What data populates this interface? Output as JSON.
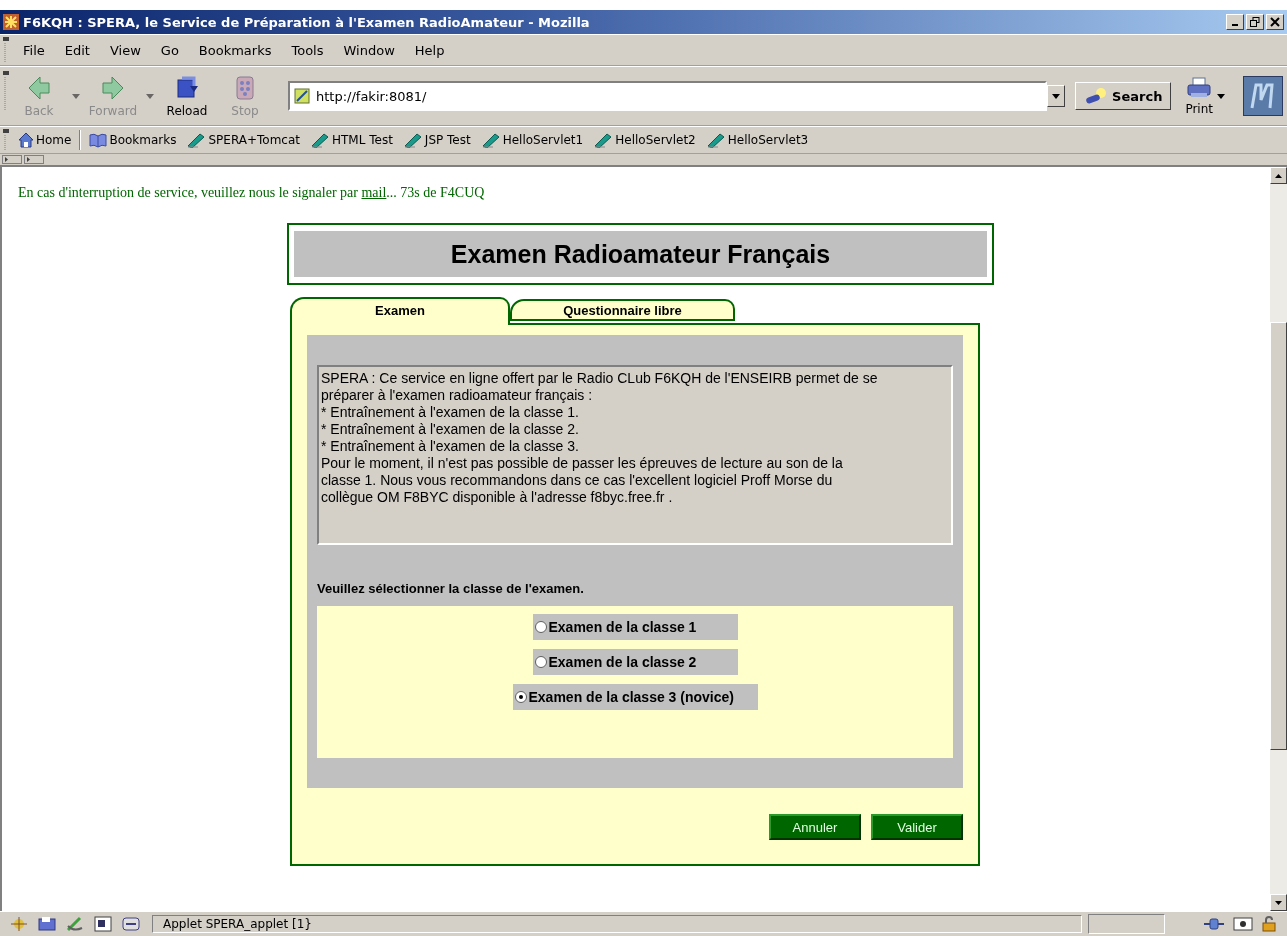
{
  "window": {
    "title": "F6KQH : SPERA, le Service de Préparation à l'Examen RadioAmateur - Mozilla"
  },
  "menu": [
    "File",
    "Edit",
    "View",
    "Go",
    "Bookmarks",
    "Tools",
    "Window",
    "Help"
  ],
  "nav_buttons": [
    {
      "label": "Back",
      "disabled": true,
      "kind": "back"
    },
    {
      "label": "Forward",
      "disabled": true,
      "kind": "forward"
    },
    {
      "label": "Reload",
      "disabled": false,
      "kind": "reload"
    },
    {
      "label": "Stop",
      "disabled": true,
      "kind": "stop"
    }
  ],
  "address": {
    "value": "http://fakir:8081/"
  },
  "search_button": "Search",
  "print_button": "Print",
  "bookmarks": [
    {
      "label": "Home",
      "kind": "home"
    },
    {
      "label": "Bookmarks",
      "kind": "folder"
    },
    {
      "label": "SPERA+Tomcat",
      "kind": "link"
    },
    {
      "label": "HTML Test",
      "kind": "link"
    },
    {
      "label": "JSP Test",
      "kind": "link"
    },
    {
      "label": "HelloServlet1",
      "kind": "link"
    },
    {
      "label": "HelloServlet2",
      "kind": "link"
    },
    {
      "label": "HelloServlet3",
      "kind": "link"
    }
  ],
  "notice": {
    "before": "En cas d'interruption de service, veuillez nous le signaler par ",
    "link": "mail",
    "after": "... 73s de F4CUQ"
  },
  "exam": {
    "title": "Examen Radioamateur Français",
    "tabs": [
      {
        "label": "Examen",
        "selected": true
      },
      {
        "label": "Questionnaire libre",
        "selected": false
      }
    ],
    "info_lines": [
      "SPERA : Ce service en ligne offert par le Radio CLub F6KQH de l'ENSEIRB permet de se",
      "préparer à l'examen radioamateur français :",
      "* Entraînement à l'examen de la classe 1.",
      "* Entraînement à l'examen de la classe 2.",
      "* Entraînement à l'examen de la classe 3.",
      "Pour le moment, il n'est pas possible de passer les épreuves de lecture au son de la",
      "classe 1. Nous vous recommandons dans ce cas l'excellent logiciel Proff Morse du",
      "collègue OM F8BYC disponible à l'adresse f8byc.free.fr ."
    ],
    "prompt": "Veuillez sélectionner la classe de l'examen.",
    "options": [
      {
        "label": "Examen de la classe 1",
        "selected": false
      },
      {
        "label": "Examen de la classe 2",
        "selected": false
      },
      {
        "label": "Examen de la classe 3 (novice)",
        "selected": true
      }
    ],
    "buttons": [
      "Annuler",
      "Valider"
    ]
  },
  "status_bar": {
    "text": "Applet SPERA_applet [1}"
  }
}
